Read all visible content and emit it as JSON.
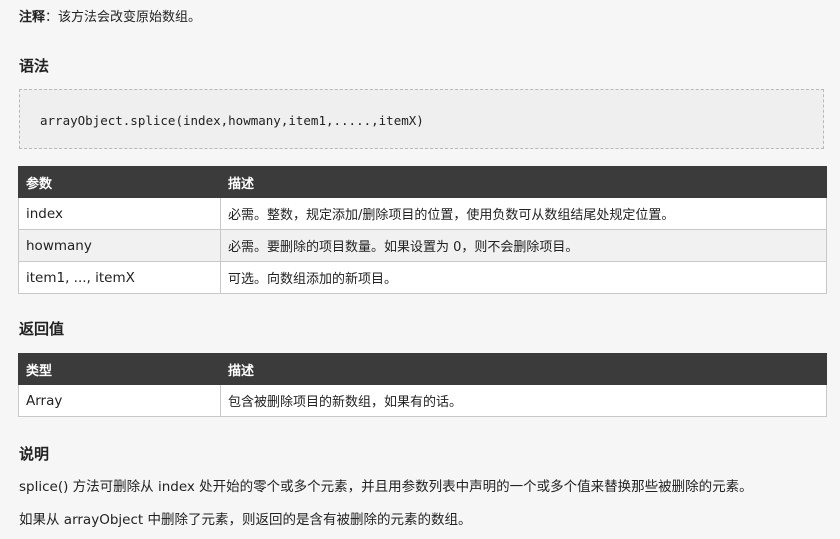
{
  "note": {
    "label": "注释",
    "text": "：该方法会改变原始数组。"
  },
  "syntax": {
    "heading": "语法",
    "code": "arrayObject.splice(index,howmany,item1,.....,itemX)"
  },
  "params_table": {
    "headers": [
      "参数",
      "描述"
    ],
    "rows": [
      [
        "index",
        "必需。整数，规定添加/删除项目的位置，使用负数可从数组结尾处规定位置。"
      ],
      [
        "howmany",
        "必需。要删除的项目数量。如果设置为 0，则不会删除项目。"
      ],
      [
        "item1, ..., itemX",
        "可选。向数组添加的新项目。"
      ]
    ]
  },
  "return_value": {
    "heading": "返回值",
    "headers": [
      "类型",
      "描述"
    ],
    "rows": [
      [
        "Array",
        "包含被删除项目的新数组，如果有的话。"
      ]
    ]
  },
  "description": {
    "heading": "说明",
    "p1": "splice() 方法可删除从 index 处开始的零个或多个元素，并且用参数列表中声明的一个或多个值来替换那些被删除的元素。",
    "p2": "如果从 arrayObject 中删除了元素，则返回的是含有被删除的元素的数组。"
  }
}
